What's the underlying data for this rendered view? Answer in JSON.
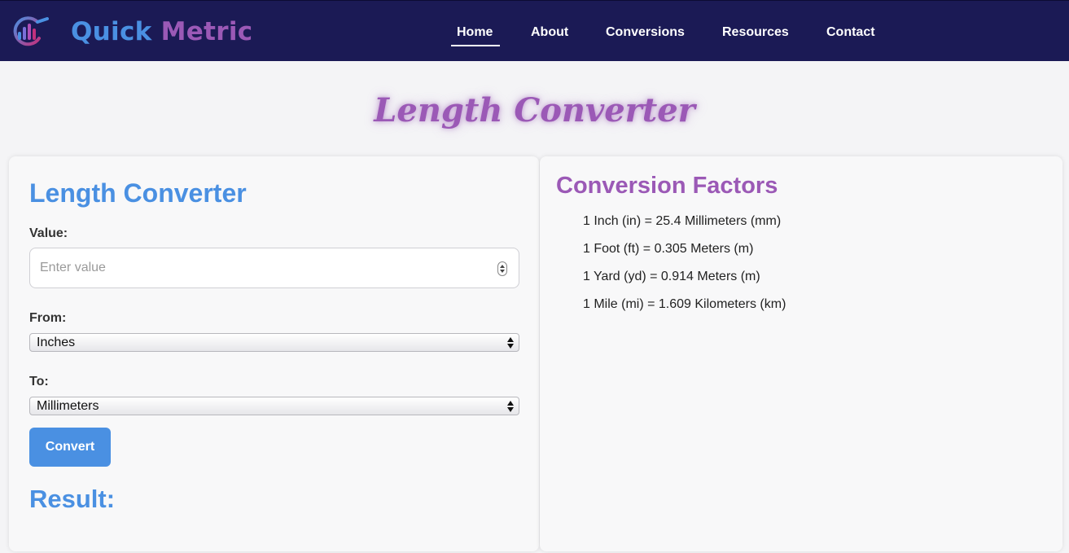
{
  "brand": {
    "name_part1": "Quick",
    "name_part2": "Metric",
    "logo_icon": "bar-chart-ring-icon",
    "colors": {
      "primary": "#4a90e2",
      "accent": "#9b59b6",
      "navbar": "#1b1a55"
    }
  },
  "nav": {
    "items": [
      {
        "label": "Home",
        "active": true
      },
      {
        "label": "About"
      },
      {
        "label": "Conversions"
      },
      {
        "label": "Resources"
      },
      {
        "label": "Contact"
      }
    ]
  },
  "page": {
    "heading": "Length Converter"
  },
  "converter": {
    "title": "Length Converter",
    "value_label": "Value:",
    "value_placeholder": "Enter value",
    "from_label": "From:",
    "from_selected": "Inches",
    "to_label": "To:",
    "to_selected": "Millimeters",
    "convert_label": "Convert",
    "result_heading": "Result:"
  },
  "factors": {
    "title": "Conversion Factors",
    "items": [
      "1 Inch (in) = 25.4 Millimeters (mm)",
      "1 Foot (ft) = 0.305 Meters (m)",
      "1 Yard (yd) = 0.914 Meters (m)",
      "1 Mile (mi) = 1.609 Kilometers (km)"
    ]
  }
}
